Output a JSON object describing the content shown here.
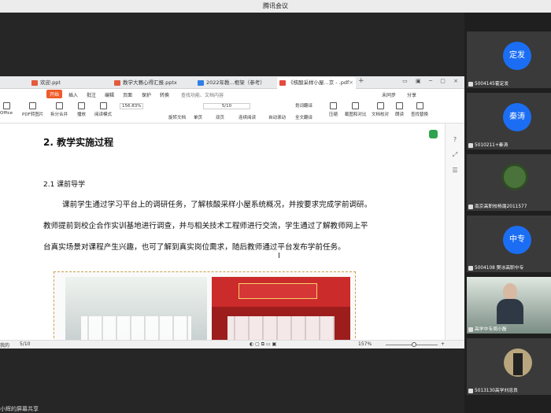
{
  "window": {
    "title": "腾讯会议"
  },
  "tabs": [
    {
      "label": "欢迎.ppt",
      "color": "#e25b3c"
    },
    {
      "label": "教学大赛心得汇报.pptx",
      "color": "#e25b3c"
    },
    {
      "label": "2022年教...框架（参考）",
      "color": "#2f7fe5"
    },
    {
      "label": "《核酸采样小屋...京 - .pdf",
      "color": "#e44b3c"
    }
  ],
  "menu": {
    "start": "开始",
    "items": [
      "插入",
      "批注",
      "编辑",
      "页面",
      "保护",
      "转换"
    ],
    "search": "查找功能、文档内容",
    "right": [
      "未同步",
      "分享"
    ]
  },
  "ribbon": {
    "buttons": [
      "Office",
      "PDF转图片",
      "拆分合并",
      "播放",
      "阅读模式",
      "旋转文档",
      "单页",
      "双页",
      "连续阅读",
      "自动滚动",
      "划词翻译",
      "全文翻译",
      "压缩",
      "截图和对比",
      "文档校对",
      "朗读",
      "查找替换"
    ],
    "zoom": "156.83%",
    "page": "5/10"
  },
  "doc": {
    "heading": "2. 教学实施过程",
    "subheading": "2.1 课前导学",
    "paragraph": "课前学生通过学习平台上的调研任务，了解核酸采样小屋系统概况，并按要求完成学前调研。教师提前到校企合作实训基地进行调查，并与相关技术工程师进行交流，学生通过了解教师网上平台真实场景对课程产生兴趣，也可了解到真实岗位需求，随后教师通过平台发布学前任务。"
  },
  "status": {
    "page": "5/10",
    "zoom": "157%",
    "left_label": "我的"
  },
  "footer": {
    "left_text": "小辉的屏幕共享"
  },
  "participants": [
    {
      "avatar": "定发",
      "name": "5004145霍定发",
      "type": "avatar"
    },
    {
      "avatar": "秦涛",
      "name": "5010211+秦涛",
      "type": "avatar"
    },
    {
      "avatar": "",
      "name": "南京高职校杨潞2011577",
      "type": "turtle"
    },
    {
      "avatar": "中专",
      "name": "5004108 樊冰高职中专",
      "type": "avatar"
    },
    {
      "avatar": "",
      "name": "高学中专周小磊",
      "type": "camera"
    },
    {
      "avatar": "",
      "name": "5013130高学刘忠良",
      "type": "photo"
    }
  ]
}
